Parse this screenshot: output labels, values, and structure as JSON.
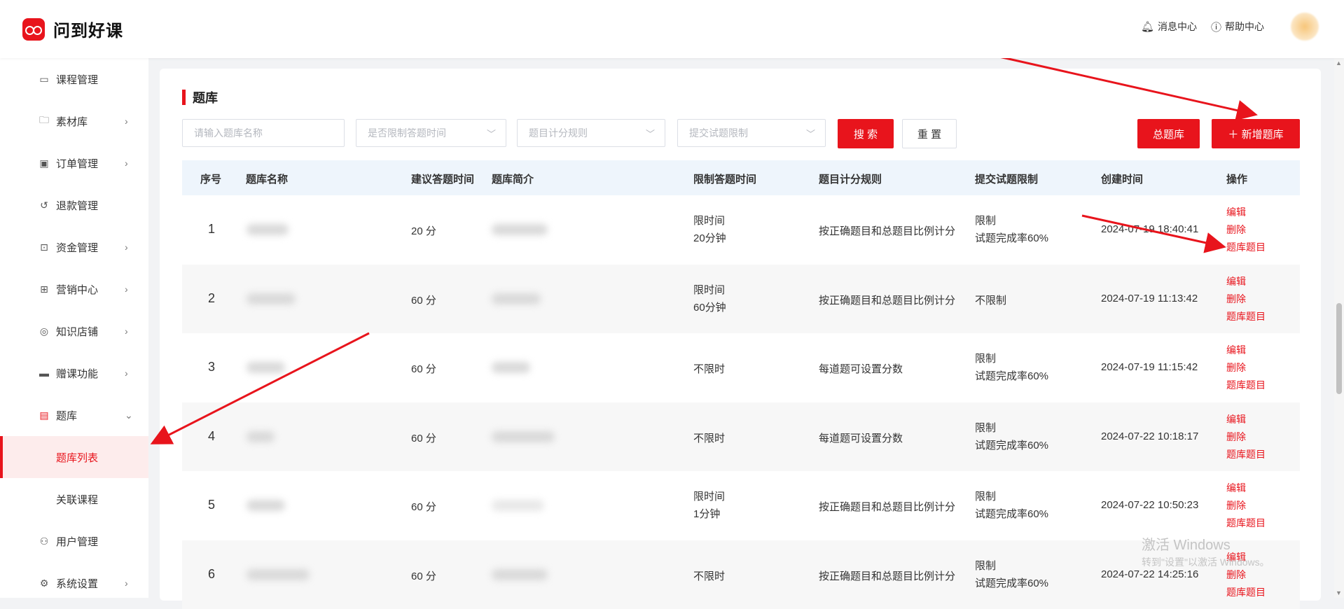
{
  "app": {
    "logo_text": "问到好课"
  },
  "header": {
    "messages": "消息中心",
    "help": "帮助中心"
  },
  "sidebar": {
    "items": [
      {
        "label": "课程管理",
        "icon": "chat-icon",
        "chev": ""
      },
      {
        "label": "素材库",
        "icon": "folder-icon",
        "chev": "›"
      },
      {
        "label": "订单管理",
        "icon": "monitor-icon",
        "chev": "›"
      },
      {
        "label": "退款管理",
        "icon": "refund-icon",
        "chev": ""
      },
      {
        "label": "资金管理",
        "icon": "wallet-icon",
        "chev": "›"
      },
      {
        "label": "营销中心",
        "icon": "gift-icon",
        "chev": "›"
      },
      {
        "label": "知识店铺",
        "icon": "shop-icon",
        "chev": "›"
      },
      {
        "label": "赠课功能",
        "icon": "present-icon",
        "chev": "›"
      },
      {
        "label": "题库",
        "icon": "question-bank-icon",
        "chev": "⌄"
      },
      {
        "label": "题库列表",
        "icon": "",
        "chev": ""
      },
      {
        "label": "关联课程",
        "icon": "",
        "chev": ""
      },
      {
        "label": "用户管理",
        "icon": "user-icon",
        "chev": ""
      },
      {
        "label": "系统设置",
        "icon": "gear-icon",
        "chev": "›"
      }
    ],
    "active_label": "题库列表"
  },
  "page": {
    "title": "题库",
    "filters": {
      "name_placeholder": "请输入题库名称",
      "time_limit_placeholder": "是否限制答题时间",
      "scoring_placeholder": "题目计分规则",
      "submit_limit_placeholder": "提交试题限制"
    },
    "buttons": {
      "search": "搜 索",
      "reset": "重 置",
      "total_bank": "总题库",
      "add_bank": "＋ 新增题库"
    }
  },
  "table": {
    "headers": [
      "序号",
      "题库名称",
      "建议答题时间",
      "题库简介",
      "限制答题时间",
      "题目计分规则",
      "提交试题限制",
      "创建时间",
      "操作"
    ],
    "rows": [
      {
        "seq": "1",
        "suggest_time": "20 分",
        "limit_time": [
          "限时间",
          "20分钟"
        ],
        "scoring": "按正确题目和总题目比例计分",
        "submit_limit": [
          "限制",
          "试题完成率60%"
        ],
        "created": "2024-07-19 18:40:41"
      },
      {
        "seq": "2",
        "suggest_time": "60 分",
        "limit_time": [
          "限时间",
          "60分钟"
        ],
        "scoring": "按正确题目和总题目比例计分",
        "submit_limit": [
          "不限制"
        ],
        "created": "2024-07-19 11:13:42"
      },
      {
        "seq": "3",
        "suggest_time": "60 分",
        "limit_time": [
          "不限时"
        ],
        "scoring": "每道题可设置分数",
        "submit_limit": [
          "限制",
          "试题完成率60%"
        ],
        "created": "2024-07-19 11:15:42"
      },
      {
        "seq": "4",
        "suggest_time": "60 分",
        "limit_time": [
          "不限时"
        ],
        "scoring": "每道题可设置分数",
        "submit_limit": [
          "限制",
          "试题完成率60%"
        ],
        "created": "2024-07-22 10:18:17"
      },
      {
        "seq": "5",
        "suggest_time": "60 分",
        "limit_time": [
          "限时间",
          "1分钟"
        ],
        "scoring": "按正确题目和总题目比例计分",
        "submit_limit": [
          "限制",
          "试题完成率60%"
        ],
        "created": "2024-07-22 10:50:23"
      },
      {
        "seq": "6",
        "suggest_time": "60 分",
        "limit_time": [
          "不限时"
        ],
        "scoring": "按正确题目和总题目比例计分",
        "submit_limit": [
          "限制",
          "试题完成率60%"
        ],
        "created": "2024-07-22 14:25:16"
      }
    ],
    "ops": {
      "edit": "编辑",
      "delete": "删除",
      "questions": "题库题目"
    }
  },
  "watermark": {
    "line1": "激活 Windows",
    "line2": "转到\"设置\"以激活 Windows。"
  },
  "colors": {
    "accent": "#e8141c",
    "table_header": "#eef5fc",
    "alt_row": "#f7f7f7"
  }
}
